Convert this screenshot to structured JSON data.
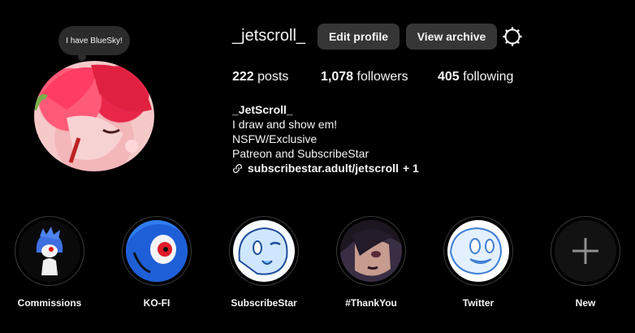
{
  "note": {
    "text": "I have BlueSky!"
  },
  "profile": {
    "username": "_jetscroll_",
    "edit_label": "Edit profile",
    "archive_label": "View archive"
  },
  "stats": {
    "posts_count": "222",
    "posts_label": "posts",
    "followers_count": "1,078",
    "followers_label": "followers",
    "following_count": "405",
    "following_label": "following"
  },
  "bio": {
    "name": "_JetScroll_",
    "lines": [
      "I draw and show em!",
      "NSFW/Exclusive",
      "Patreon and SubscribeStar"
    ],
    "link": "subscribestar.adult/jetscroll",
    "link_more": "+ 1"
  },
  "highlights": [
    {
      "label": "Commissions"
    },
    {
      "label": "KO-FI"
    },
    {
      "label": "SubscribeStar"
    },
    {
      "label": "#ThankYou"
    },
    {
      "label": "Twitter"
    },
    {
      "label": "New"
    }
  ],
  "colors": {
    "background": "#000000",
    "button": "#363636",
    "text": "#f5f5f5"
  },
  "icons": [
    "gear-icon",
    "link-icon",
    "plus-icon"
  ]
}
